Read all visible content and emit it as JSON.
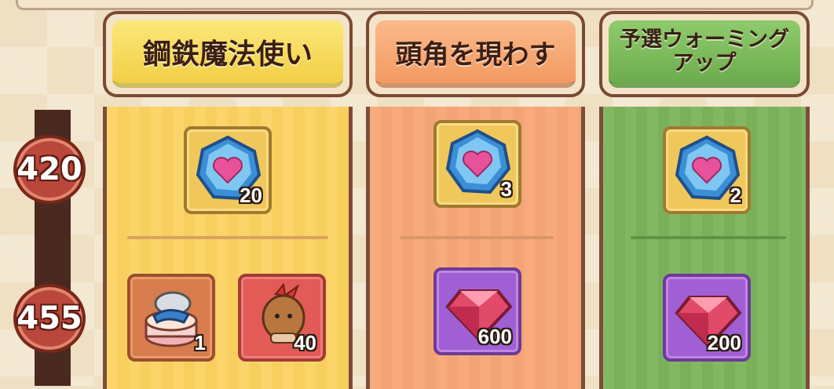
{
  "tiers": [
    {
      "level": "420"
    },
    {
      "level": "455"
    }
  ],
  "columns": [
    {
      "title": "鋼鉄魔法使い",
      "color": "#f6d64f"
    },
    {
      "title": "頭角を現わす",
      "color": "#f8a36f"
    },
    {
      "title": "予選ウォーミングアップ",
      "color": "#76b957"
    }
  ],
  "rewards": {
    "col1_tier1": {
      "icon": "heart-crystal-icon",
      "qty": "20"
    },
    "col2_tier1": {
      "icon": "heart-crystal-icon",
      "qty": "3"
    },
    "col3_tier1": {
      "icon": "heart-crystal-icon",
      "qty": "2"
    },
    "col1_tier2a": {
      "icon": "cake-character-icon",
      "qty": "1"
    },
    "col1_tier2b": {
      "icon": "cookie-character-icon",
      "qty": "40"
    },
    "col2_tier2": {
      "icon": "ruby-gem-icon",
      "qty": "600"
    },
    "col3_tier2": {
      "icon": "ruby-gem-icon",
      "qty": "200"
    }
  }
}
